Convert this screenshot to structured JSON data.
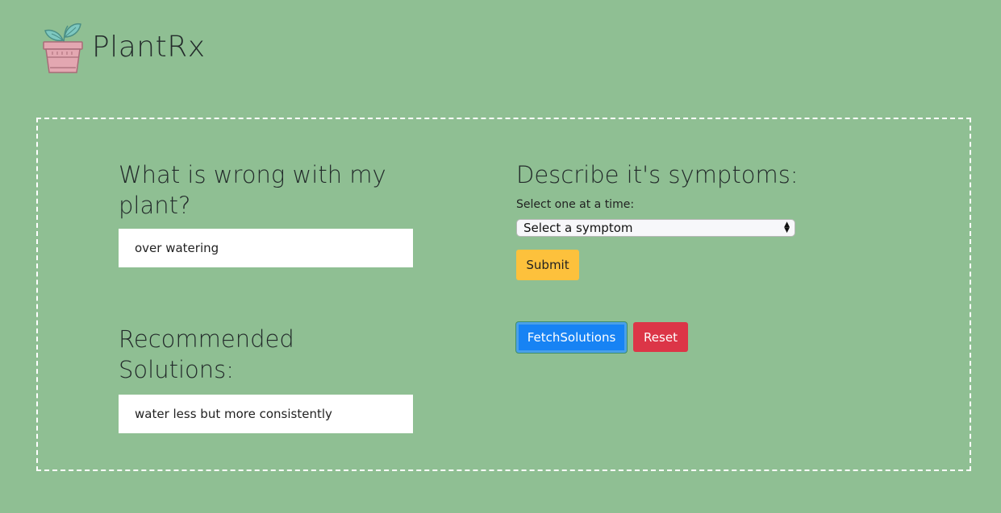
{
  "header": {
    "brand": "PlantRx",
    "logo_icon": "plant-pot-icon"
  },
  "problem": {
    "heading": "What is wrong with my plant?",
    "value": "over watering"
  },
  "solutions": {
    "heading": "Recommended Solutions:",
    "value": "water less but more consistently"
  },
  "symptoms": {
    "heading": "Describe it's symptoms:",
    "hint": "Select one at a time:",
    "select_value": "Select a symptom",
    "submit_label": "Submit"
  },
  "actions": {
    "fetch_label": "FetchSolutions",
    "reset_label": "Reset"
  },
  "colors": {
    "background": "#8fbf93",
    "submit": "#fdc13c",
    "fetch": "#1783f4",
    "reset": "#dc3547"
  }
}
